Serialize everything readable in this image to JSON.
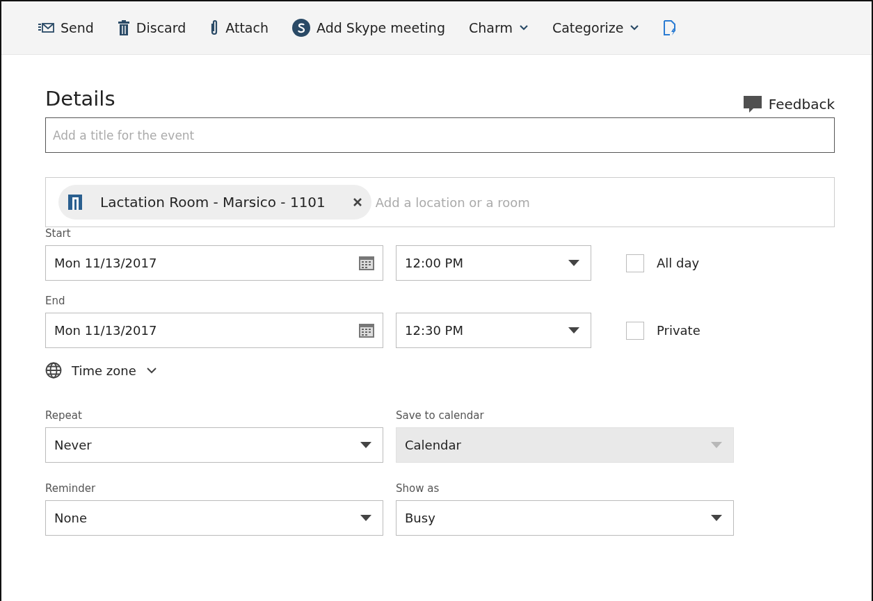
{
  "toolbar": [
    {
      "kind": "button",
      "label": "Send"
    },
    {
      "kind": "button",
      "label": "Discard"
    },
    {
      "kind": "button",
      "label": "Attach"
    },
    {
      "kind": "button",
      "label": "Add Skype meeting"
    },
    {
      "kind": "dropdown",
      "label": "Charm"
    },
    {
      "kind": "dropdown",
      "label": "Categorize"
    },
    {
      "kind": "icon"
    }
  ],
  "heading": "Details",
  "feedback": "Feedback",
  "title_field": {
    "placeholder": "Add a title for the event"
  },
  "location": {
    "chip": "Lactation Room - Marsico - 1101",
    "placeholder": "Add a location or a room"
  },
  "start": {
    "label": "Start",
    "date": "Mon 11/13/2017",
    "time": "12:00 PM",
    "checkbox": {
      "label": "All day",
      "checked": false
    }
  },
  "end": {
    "label": "End",
    "date": "Mon 11/13/2017",
    "time": "12:30 PM",
    "checkbox": {
      "label": "Private",
      "checked": false
    }
  },
  "time_zone": "Time zone",
  "selects": [
    {
      "label": "Repeat",
      "value": "Never",
      "disabled": false
    },
    {
      "label": "Save to calendar",
      "value": "Calendar",
      "disabled": true
    },
    {
      "label": "Reminder",
      "value": "None",
      "disabled": false
    },
    {
      "label": "Show as",
      "value": "Busy",
      "disabled": false
    }
  ]
}
